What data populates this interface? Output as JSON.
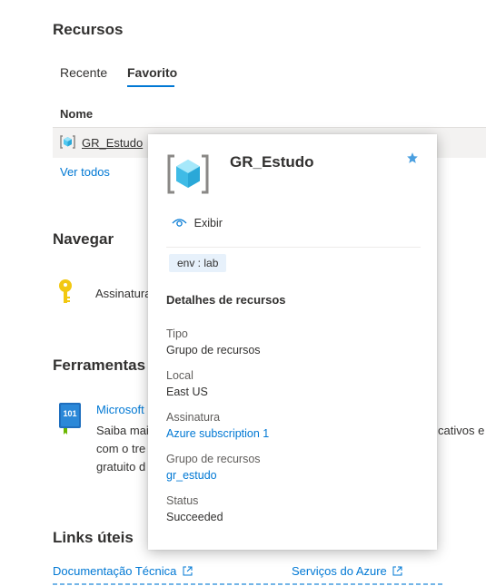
{
  "resources": {
    "title": "Recursos",
    "tabs": [
      {
        "label": "Recente"
      },
      {
        "label": "Favorito"
      }
    ],
    "column_header": "Nome",
    "row": {
      "name": "GR_Estudo"
    },
    "see_all": "Ver todos"
  },
  "navigate": {
    "title": "Navegar",
    "item_label": "Assinaturas"
  },
  "tools": {
    "title": "Ferramentas",
    "item_title": "Microsoft",
    "item_desc_1": "Saiba mai",
    "item_desc_1_end": "cativos e",
    "item_desc_2": "com o tre",
    "item_desc_3": "gratuito d",
    "badge_text": "101"
  },
  "links": {
    "title": "Links úteis",
    "left": "Documentação Técnica",
    "right": "Serviços do Azure"
  },
  "card": {
    "title": "GR_Estudo",
    "view_label": "Exibir",
    "tag": "env : lab",
    "section_title": "Detalhes de recursos",
    "type_label": "Tipo",
    "type_value": "Grupo de recursos",
    "location_label": "Local",
    "location_value": "East US",
    "subscription_label": "Assinatura",
    "subscription_value": "Azure subscription 1",
    "rg_label": "Grupo de recursos",
    "rg_value": "gr_estudo",
    "status_label": "Status",
    "status_value": "Succeeded"
  },
  "colors": {
    "accent": "#0078d4",
    "star": "#4a9fe0",
    "key": "#f2c811"
  }
}
